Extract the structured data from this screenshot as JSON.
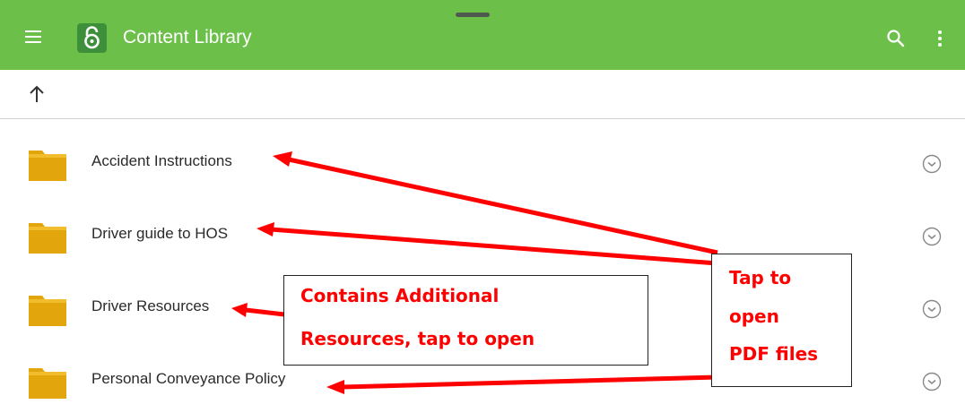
{
  "app": {
    "title": "Content Library",
    "accent_color": "#6cc04a",
    "icons": {
      "menu": "menu-icon",
      "logo": "open-lock-icon",
      "search": "search-icon",
      "more": "more-vert-icon",
      "up": "arrow-up-icon",
      "folder": "folder-icon",
      "row_more": "chevron-down-circle-icon"
    }
  },
  "folders": [
    {
      "label": "Accident Instructions"
    },
    {
      "label": "Driver guide to HOS"
    },
    {
      "label": "Driver Resources"
    },
    {
      "label": "Personal Conveyance Policy"
    }
  ],
  "annotations": {
    "left_box": {
      "line1": "Contains Additional",
      "line2": "Resources, tap to open"
    },
    "right_box": {
      "line1": "Tap to",
      "line2": "open",
      "line3": "PDF files"
    },
    "color": "#ff0000"
  }
}
